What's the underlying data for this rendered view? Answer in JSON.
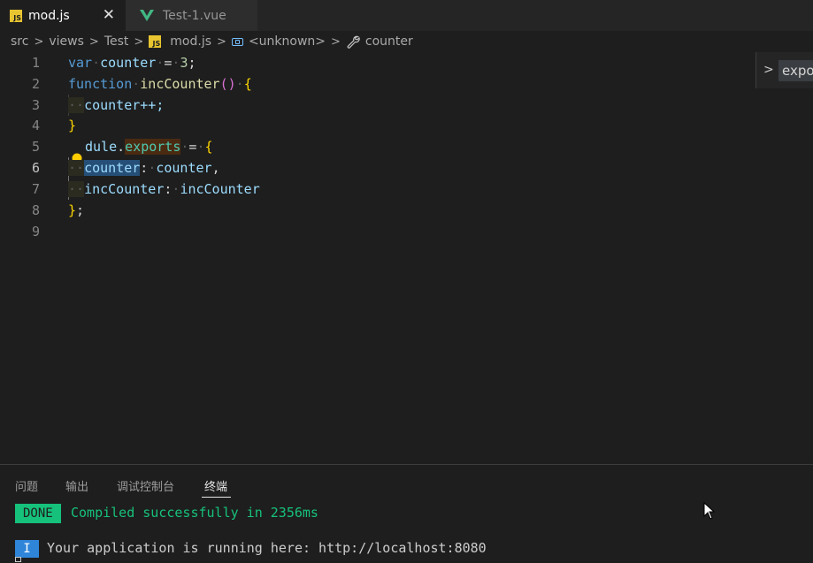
{
  "tabs": [
    {
      "label": "mod.js",
      "icon": "js-file-icon",
      "active": true
    },
    {
      "label": "Test-1.vue",
      "icon": "vue-file-icon",
      "active": false
    }
  ],
  "breadcrumb": {
    "items": [
      "src",
      "views",
      "Test",
      "mod.js",
      "<unknown>",
      "counter"
    ],
    "js_badge": "JS"
  },
  "editor": {
    "line_numbers": [
      "1",
      "2",
      "3",
      "4",
      "5",
      "6",
      "7",
      "8",
      "9"
    ],
    "current_line": "6",
    "lines": {
      "l1": {
        "kw": "var",
        "name": "counter",
        "op": "=",
        "num": "3",
        "end": ";"
      },
      "l2": {
        "kw": "function",
        "name": "incCounter",
        "parens": "()",
        "brace": "{"
      },
      "l3": {
        "text": "counter++;"
      },
      "l4": {
        "brace": "}"
      },
      "l5": {
        "obj": "dule",
        "dot": ".",
        "prop": "exports",
        "op": "=",
        "brace": "{"
      },
      "l6": {
        "key": "counter",
        "colon": ":",
        "value": "counter",
        "comma": ","
      },
      "l7": {
        "key": "incCounter",
        "colon": ":",
        "value": "incCounter"
      },
      "l8": {
        "brace": "}",
        "end": ";"
      }
    }
  },
  "peek": {
    "label": "expo"
  },
  "panel": {
    "tabs": [
      "问题",
      "输出",
      "调试控制台",
      "终端"
    ],
    "active_tab": "终端",
    "done_badge": "DONE",
    "done_message": "Compiled successfully in 2356ms",
    "info_badge": "I",
    "info_message": "Your application is running here: http://localhost:8080"
  },
  "colors": {
    "done": "#16c17b",
    "info": "#2f86d9",
    "keyword": "#569cd6",
    "variable": "#9cdcfe",
    "function": "#dcdcaa"
  }
}
